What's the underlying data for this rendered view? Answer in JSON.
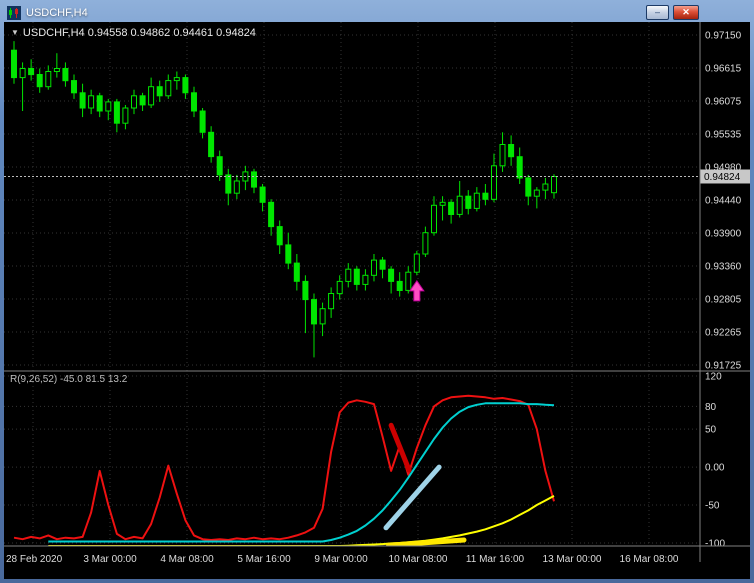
{
  "window": {
    "title": "USDCHF,H4",
    "minimize_label": "–",
    "close_label": "✕"
  },
  "chart": {
    "symbol_header_icon": "▼",
    "symbol_header": "USDCHF,H4  0.94558 0.94862 0.94461 0.94824",
    "price_axis": {
      "labels": [
        "0.97150",
        "0.96615",
        "0.96075",
        "0.95535",
        "0.94980",
        "0.94440",
        "0.93900",
        "0.93360",
        "0.92805",
        "0.92265",
        "0.91725"
      ],
      "current_price": "0.94824"
    },
    "time_axis": {
      "labels": [
        "28 Feb 2020",
        "3 Mar 00:00",
        "4 Mar 08:00",
        "5 Mar 16:00",
        "9 Mar 00:00",
        "10 Mar 08:00",
        "11 Mar 16:00",
        "13 Mar 00:00",
        "16 Mar 08:00"
      ]
    },
    "colors": {
      "background": "#000000",
      "grid": "#343434",
      "candle": "#00e600",
      "axis_text": "#dcdcdc",
      "price_badge_bg": "#c8c8c8",
      "separator": "#808080"
    }
  },
  "indicator": {
    "label": "R(9,26,52) -45.0 81.5 13.2",
    "axis_labels": [
      "120",
      "80",
      "50",
      "0.00",
      "-50",
      "-100"
    ]
  },
  "chart_data": {
    "type": "candlestick",
    "symbol": "USDCHF",
    "timeframe": "H4",
    "ohlc": {
      "open": 0.94558,
      "high": 0.94862,
      "low": 0.94461,
      "close": 0.94824
    },
    "price_range": {
      "top": 0.9715,
      "bottom": 0.91725
    },
    "candles": [
      [
        0.969,
        0.9705,
        0.9635,
        0.9645
      ],
      [
        0.9645,
        0.967,
        0.959,
        0.966
      ],
      [
        0.966,
        0.9675,
        0.964,
        0.965
      ],
      [
        0.965,
        0.966,
        0.962,
        0.963
      ],
      [
        0.963,
        0.9665,
        0.9625,
        0.9655
      ],
      [
        0.9655,
        0.9685,
        0.9645,
        0.966
      ],
      [
        0.966,
        0.967,
        0.963,
        0.964
      ],
      [
        0.964,
        0.965,
        0.961,
        0.962
      ],
      [
        0.962,
        0.9635,
        0.958,
        0.9595
      ],
      [
        0.9595,
        0.9625,
        0.9585,
        0.9615
      ],
      [
        0.9615,
        0.962,
        0.958,
        0.959
      ],
      [
        0.959,
        0.961,
        0.9575,
        0.9605
      ],
      [
        0.9605,
        0.961,
        0.9555,
        0.957
      ],
      [
        0.957,
        0.96,
        0.956,
        0.9595
      ],
      [
        0.9595,
        0.9625,
        0.9585,
        0.9615
      ],
      [
        0.9615,
        0.962,
        0.959,
        0.96
      ],
      [
        0.96,
        0.9645,
        0.9595,
        0.963
      ],
      [
        0.963,
        0.964,
        0.9605,
        0.9615
      ],
      [
        0.9615,
        0.965,
        0.961,
        0.964
      ],
      [
        0.964,
        0.9655,
        0.9625,
        0.9645
      ],
      [
        0.9645,
        0.965,
        0.961,
        0.962
      ],
      [
        0.962,
        0.963,
        0.958,
        0.959
      ],
      [
        0.959,
        0.9595,
        0.9545,
        0.9555
      ],
      [
        0.9555,
        0.9565,
        0.9505,
        0.9515
      ],
      [
        0.9515,
        0.9525,
        0.9475,
        0.9485
      ],
      [
        0.9485,
        0.9495,
        0.9435,
        0.9455
      ],
      [
        0.9455,
        0.9485,
        0.9445,
        0.9475
      ],
      [
        0.9475,
        0.95,
        0.946,
        0.949
      ],
      [
        0.949,
        0.9495,
        0.9455,
        0.9465
      ],
      [
        0.9465,
        0.947,
        0.9425,
        0.944
      ],
      [
        0.944,
        0.9445,
        0.9385,
        0.94
      ],
      [
        0.94,
        0.941,
        0.9355,
        0.937
      ],
      [
        0.937,
        0.939,
        0.933,
        0.934
      ],
      [
        0.934,
        0.9355,
        0.9295,
        0.931
      ],
      [
        0.931,
        0.932,
        0.9225,
        0.928
      ],
      [
        0.928,
        0.929,
        0.9185,
        0.924
      ],
      [
        0.924,
        0.9275,
        0.922,
        0.9265
      ],
      [
        0.9265,
        0.93,
        0.925,
        0.929
      ],
      [
        0.929,
        0.932,
        0.928,
        0.931
      ],
      [
        0.931,
        0.934,
        0.93,
        0.933
      ],
      [
        0.933,
        0.9335,
        0.9295,
        0.9305
      ],
      [
        0.9305,
        0.933,
        0.9295,
        0.932
      ],
      [
        0.932,
        0.9355,
        0.931,
        0.9345
      ],
      [
        0.9345,
        0.935,
        0.9315,
        0.933
      ],
      [
        0.933,
        0.9335,
        0.929,
        0.931
      ],
      [
        0.931,
        0.9325,
        0.9285,
        0.9295
      ],
      [
        0.9295,
        0.9335,
        0.929,
        0.9325
      ],
      [
        0.9325,
        0.936,
        0.932,
        0.9355
      ],
      [
        0.9355,
        0.94,
        0.935,
        0.939
      ],
      [
        0.939,
        0.945,
        0.9385,
        0.9435
      ],
      [
        0.9435,
        0.945,
        0.941,
        0.944
      ],
      [
        0.944,
        0.9445,
        0.9405,
        0.942
      ],
      [
        0.942,
        0.9475,
        0.9415,
        0.945
      ],
      [
        0.945,
        0.946,
        0.942,
        0.943
      ],
      [
        0.943,
        0.9465,
        0.9425,
        0.9455
      ],
      [
        0.9455,
        0.947,
        0.9435,
        0.9445
      ],
      [
        0.9445,
        0.952,
        0.944,
        0.95
      ],
      [
        0.95,
        0.9555,
        0.949,
        0.9535
      ],
      [
        0.9535,
        0.955,
        0.95,
        0.9515
      ],
      [
        0.9515,
        0.953,
        0.947,
        0.948
      ],
      [
        0.948,
        0.9485,
        0.9435,
        0.945
      ],
      [
        0.945,
        0.9465,
        0.943,
        0.946
      ],
      [
        0.946,
        0.948,
        0.9445,
        0.947
      ],
      [
        0.94558,
        0.94862,
        0.94461,
        0.94824
      ]
    ],
    "oscillator": {
      "name": "R(9,26,52)",
      "display_values": [
        -45.0,
        81.5,
        13.2
      ],
      "scale": {
        "top": 120,
        "bottom": -100
      },
      "series": [
        {
          "name": "main-red",
          "color": "#ee1111",
          "width": 2,
          "start": 0,
          "values": [
            -93,
            -95,
            -92,
            -94,
            -90,
            -95,
            -93,
            -94,
            -92,
            -60,
            -5,
            -50,
            -88,
            -95,
            -92,
            -94,
            -75,
            -40,
            2,
            -35,
            -70,
            -90,
            -95,
            -96,
            -95,
            -96,
            -94,
            -95,
            -93,
            -95,
            -94,
            -95,
            -93,
            -90,
            -86,
            -80,
            -55,
            20,
            72,
            85,
            88,
            86,
            83,
            40,
            -5,
            28,
            -10,
            25,
            55,
            80,
            88,
            92,
            93,
            94,
            93,
            92,
            90,
            91,
            89,
            87,
            82,
            50,
            -5,
            -45
          ]
        },
        {
          "name": "signal-cyan",
          "color": "#00d0d0",
          "width": 2,
          "start": 4,
          "values": [
            -98,
            -98,
            -98,
            -98,
            -98,
            -98,
            -98,
            -98,
            -98,
            -98,
            -98,
            -98,
            -98,
            -98,
            -98,
            -98,
            -98,
            -98,
            -98,
            -98,
            -98,
            -98,
            -98,
            -98,
            -98,
            -98,
            -98,
            -98,
            -98,
            -98,
            -98,
            -98,
            -98,
            -96,
            -93,
            -89,
            -84,
            -77,
            -68,
            -57,
            -44,
            -30,
            -14,
            3,
            20,
            37,
            52,
            64,
            73,
            79,
            82,
            84,
            84,
            84,
            84,
            84,
            83,
            83,
            82,
            81.5
          ]
        },
        {
          "name": "slow-yellow",
          "color": "#ffff00",
          "width": 2,
          "start": 4,
          "values": [
            -104,
            -104,
            -104,
            -104,
            -104,
            -104,
            -104,
            -104,
            -104,
            -104,
            -104,
            -104,
            -104,
            -104,
            -104,
            -104,
            -104,
            -104,
            -104,
            -104,
            -104,
            -104,
            -104,
            -104,
            -104,
            -104,
            -104,
            -104,
            -104,
            -104,
            -104,
            -104,
            -104,
            -104,
            -104,
            -103.5,
            -103,
            -102.5,
            -102,
            -101.5,
            -100.5,
            -100,
            -99,
            -98,
            -97,
            -95.5,
            -94,
            -92,
            -90,
            -87.5,
            -85,
            -82,
            -78,
            -74,
            -69,
            -63,
            -57,
            -50,
            -44,
            -38
          ]
        }
      ],
      "drawn_objects": [
        {
          "type": "trendline",
          "color": "#cc0000",
          "width": 5,
          "points": [
            [
              44.0,
              55
            ],
            [
              46.1,
              -4
            ]
          ]
        },
        {
          "type": "trendline",
          "color": "#9fd3e8",
          "width": 5,
          "points": [
            [
              43.4,
              -80
            ],
            [
              49.6,
              0
            ]
          ]
        },
        {
          "type": "trendline",
          "color": "#ffe800",
          "width": 5,
          "points": [
            [
              43.7,
              -103
            ],
            [
              52.5,
              -96
            ]
          ]
        }
      ]
    },
    "chart_objects": [
      {
        "type": "arrow-up",
        "color": "#ff4dc4",
        "candle_index": 47,
        "price": 0.9278
      }
    ]
  }
}
